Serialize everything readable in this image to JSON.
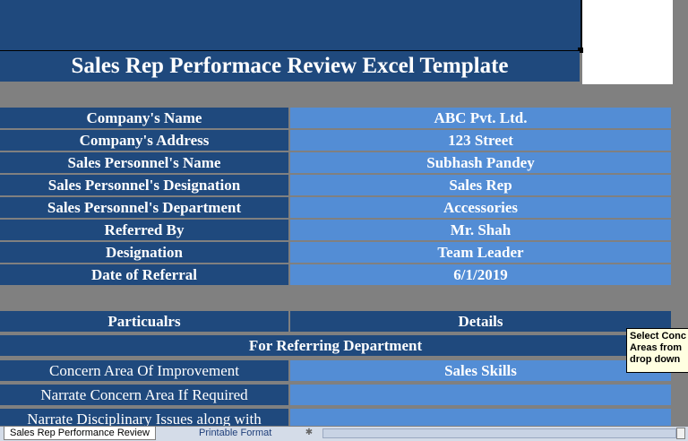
{
  "title": "Sales Rep Performace Review Excel Template",
  "info_rows": [
    {
      "label": "Company's Name",
      "value": "ABC Pvt. Ltd."
    },
    {
      "label": "Company's Address",
      "value": "123 Street"
    },
    {
      "label": "Sales Personnel's Name",
      "value": "Subhash Pandey"
    },
    {
      "label": "Sales Personnel's Designation",
      "value": "Sales Rep"
    },
    {
      "label": "Sales Personnel's Department",
      "value": "Accessories"
    },
    {
      "label": "Referred By",
      "value": "Mr. Shah"
    },
    {
      "label": "Designation",
      "value": "Team Leader"
    },
    {
      "label": "Date of Referral",
      "value": "6/1/2019"
    }
  ],
  "section": {
    "particulars_header": "Particualrs",
    "details_header": "Details",
    "subheader": "For Referring Department",
    "rows": [
      {
        "label": "Concern Area Of Improvement",
        "value": "Sales Skills"
      },
      {
        "label": "Narrate Concern Area If Required",
        "value": ""
      },
      {
        "label": "Narrate Disciplinary Issues along with",
        "value": ""
      }
    ]
  },
  "tooltip": {
    "line1": "Select Conc",
    "line2": "Areas from",
    "line3": "drop down"
  },
  "tabs": {
    "active": "Sales Rep Performance Review",
    "second": "Printable Format"
  }
}
